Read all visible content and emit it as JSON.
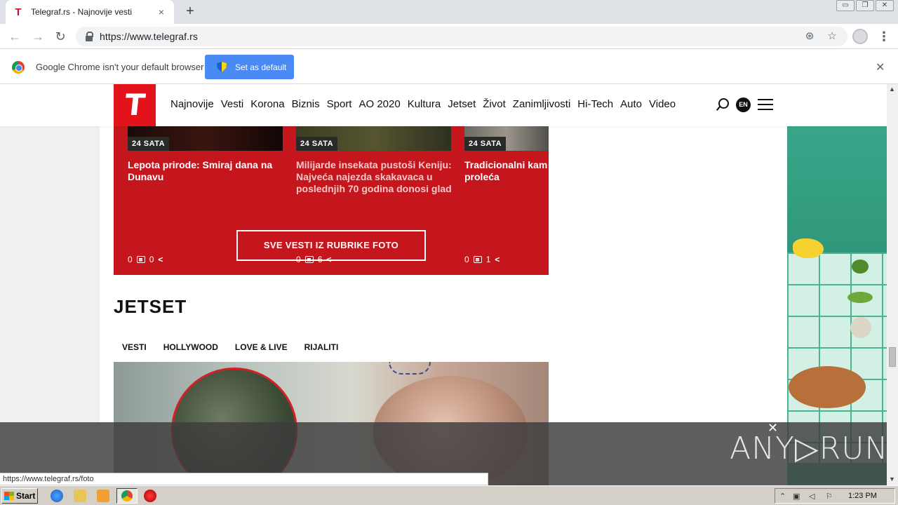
{
  "browser": {
    "tab_title": "Telegraf.rs - Najnovije vesti",
    "tab_close": "×",
    "new_tab": "+",
    "url": "https://www.telegraf.rs",
    "win_minimize": "▭",
    "win_restore": "❐",
    "win_close": "✕"
  },
  "infobar": {
    "message": "Google Chrome isn't your default browser",
    "button_label": "Set as default",
    "close": "✕"
  },
  "site": {
    "logo_letter": "T",
    "nav": [
      "Najnovije",
      "Vesti",
      "Korona",
      "Biznis",
      "Sport",
      "AO 2020",
      "Kultura",
      "Jetset",
      "Život",
      "Zanimljivosti",
      "Hi-Tech",
      "Auto",
      "Video"
    ],
    "lang": "EN"
  },
  "foto_section": {
    "cards": [
      {
        "badge": "24 SATA",
        "title": "Lepota prirode: Smiraj dana na Dunavu",
        "comments": "0",
        "shares": "0"
      },
      {
        "badge": "24 SATA",
        "title": "Milijarde insekata pustoši Keniju: Najveća najezda skakavaca u poslednjih 70 godina donosi glad",
        "comments": "0",
        "shares": "6"
      },
      {
        "badge": "24 SATA",
        "title": "Tradicionalni kam za doček proleća",
        "comments": "0",
        "shares": "1"
      }
    ],
    "all_button": "SVE VESTI IZ RUBRIKE FOTO"
  },
  "jetset": {
    "title": "JETSET",
    "tabs": [
      "VESTI",
      "HOLLYWOOD",
      "LOVE & LIVE",
      "RIJALITI"
    ]
  },
  "status_url": "https://www.telegraf.rs/foto",
  "overlay": {
    "logo": "ANY▷RUN"
  },
  "taskbar": {
    "start": "Start",
    "clock": "1:23 PM"
  },
  "colors": {
    "brand_red": "#e3131c",
    "section_red": "#c4161c",
    "chrome_blue": "#4a8af4"
  }
}
